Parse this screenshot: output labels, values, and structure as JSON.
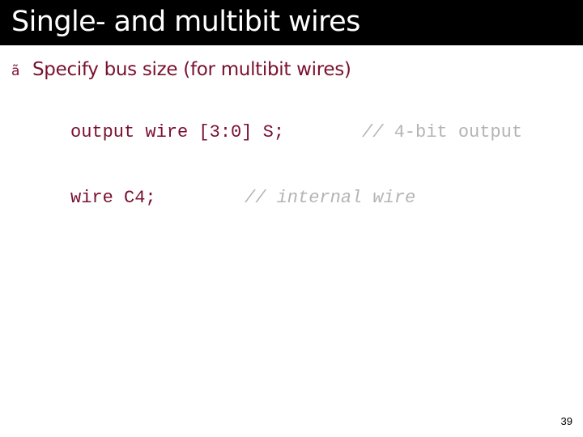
{
  "slide": {
    "title": "Single- and multibit wires",
    "bullet_glyph": "ã",
    "bullet_text": "Specify bus size (for multibit wires)",
    "code": [
      {
        "code": "output wire [3:0] S;",
        "comment_slashes": "//",
        "comment_text": " 4-bit output"
      },
      {
        "code": "wire C4;",
        "comment": "// internal wire"
      }
    ],
    "page_number": "39",
    "colors": {
      "title_bar": "#000000",
      "title_text": "#ffffff",
      "body_text": "#7a1030",
      "comment_text": "#b4b4b4"
    }
  }
}
